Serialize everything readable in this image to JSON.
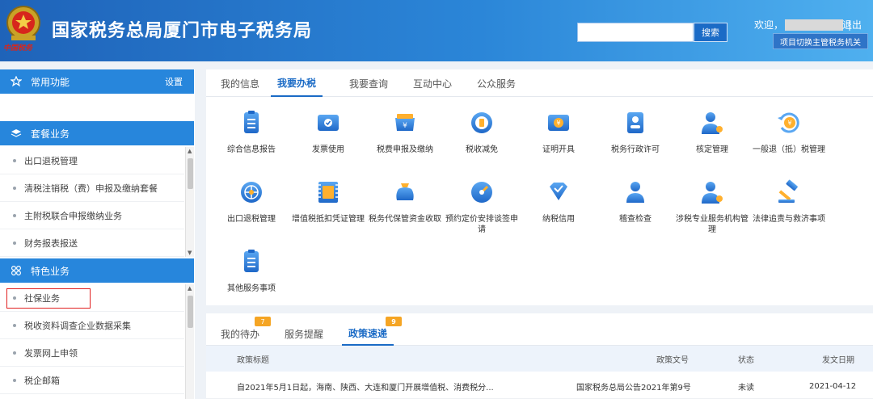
{
  "header": {
    "title": "国家税务总局厦门市电子税务局",
    "emblem_script": "中国税务",
    "search_placeholder": "",
    "search_button": "搜索",
    "welcome": "欢迎，",
    "separator": "|",
    "logout": "退出",
    "switch_button": "项目切换主管税务机关"
  },
  "sidebar": {
    "favorites": {
      "title": "常用功能",
      "settings": "设置"
    },
    "packages": {
      "title": "套餐业务",
      "items": [
        "出口退税管理",
        "清税注销税（费）申报及缴纳套餐",
        "主附税联合申报缴纳业务",
        "财务报表报送"
      ]
    },
    "features": {
      "title": "特色业务",
      "items": [
        "社保业务",
        "税收资料调查企业数据采集",
        "发票网上申领",
        "税企邮箱"
      ]
    }
  },
  "main_tabs": [
    "我的信息",
    "我要办税",
    "我要查询",
    "互动中心",
    "公众服务"
  ],
  "active_main_tab": "我要办税",
  "tiles": [
    {
      "label": "综合信息报告",
      "icon": "report-icon"
    },
    {
      "label": "发票使用",
      "icon": "invoice-icon"
    },
    {
      "label": "税费申报及缴纳",
      "icon": "tax-payment-icon"
    },
    {
      "label": "税收减免",
      "icon": "tax-relief-icon"
    },
    {
      "label": "证明开具",
      "icon": "certificate-icon"
    },
    {
      "label": "税务行政许可",
      "icon": "license-icon"
    },
    {
      "label": "核定管理",
      "icon": "verification-icon"
    },
    {
      "label": "一般退（抵）税管理",
      "icon": "refund-icon"
    },
    {
      "label": "出口退税管理",
      "icon": "export-refund-icon"
    },
    {
      "label": "增值税抵扣凭证管理",
      "icon": "vat-voucher-icon"
    },
    {
      "label": "税务代保管资金收取",
      "icon": "custody-fund-icon"
    },
    {
      "label": "预约定价安排谈签申请",
      "icon": "pricing-arrangement-icon"
    },
    {
      "label": "纳税信用",
      "icon": "credit-icon"
    },
    {
      "label": "稽查检查",
      "icon": "inspection-icon"
    },
    {
      "label": "涉税专业服务机构管理",
      "icon": "agency-icon"
    },
    {
      "label": "法律追责与救济事项",
      "icon": "gavel-icon"
    },
    {
      "label": "其他服务事项",
      "icon": "other-services-icon"
    }
  ],
  "bottom_tabs": [
    {
      "label": "我的待办",
      "badge": "7"
    },
    {
      "label": "服务提醒",
      "badge": ""
    },
    {
      "label": "政策速递",
      "badge": "9"
    }
  ],
  "active_bottom_tab": "政策速递",
  "policy_table": {
    "columns": [
      "政策标题",
      "政策文号",
      "状态",
      "发文日期"
    ],
    "rows": [
      [
        "自2021年5月1日起，海南、陕西、大连和厦门开展增值税、消费税分...",
        "国家税务总局公告2021年第9号",
        "未读",
        "2021-04-12"
      ]
    ]
  },
  "colors": {
    "header_start": "#1f63b9",
    "header_end": "#4fb0ef",
    "accent": "#1b6bc6",
    "section_header": "#2786dc",
    "badge": "#f5a524",
    "highlight": "#e02020"
  }
}
